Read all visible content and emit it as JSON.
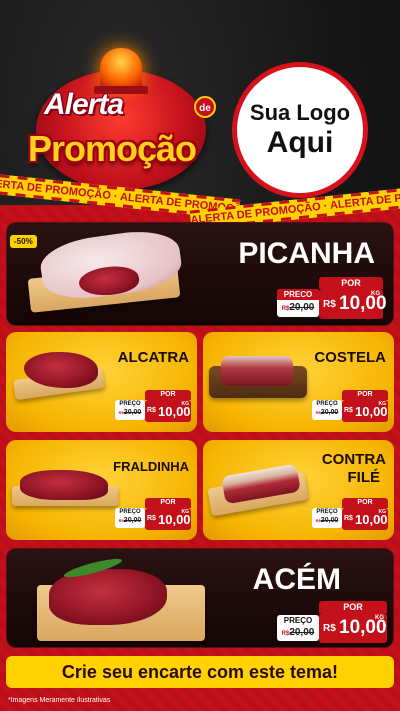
{
  "header": {
    "alerta": "Alerta",
    "de": "de",
    "promocao": "Promoção",
    "logo_line1": "Sua Logo",
    "logo_line2": "Aqui",
    "tape_text": "ALERTA DE PROMOÇÃO · ALERTA DE PROMOÇÃO · ALERTA DE PROMOÇÃO · ALERTA DE PROMOÇÃO"
  },
  "colors": {
    "accent_red": "#c4101a",
    "accent_yellow": "#ffd200",
    "dark_panel": "#1a0808"
  },
  "products": [
    {
      "name": "PICANHA",
      "badge": "-50%",
      "preco_label": "PRECO",
      "old_price": "20,00",
      "old_prefix": "R$",
      "por_label": "POR",
      "currency": "R$",
      "price": "10,00",
      "unit": "KG"
    },
    {
      "name": "ALCATRA",
      "preco_label": "PREÇO",
      "old_price": "20,00",
      "old_prefix": "R$",
      "por_label": "POR",
      "currency": "R$",
      "price": "10,00",
      "unit": "KG"
    },
    {
      "name": "COSTELA",
      "preco_label": "PREÇO",
      "old_price": "20,00",
      "old_prefix": "R$",
      "por_label": "POR",
      "currency": "R$",
      "price": "10,00",
      "unit": "KG"
    },
    {
      "name": "FRALDINHA",
      "preco_label": "PREÇO",
      "old_price": "20,00",
      "old_prefix": "R$",
      "por_label": "POR",
      "currency": "R$",
      "price": "10,00",
      "unit": "KG"
    },
    {
      "name_line1": "CONTRA",
      "name_line2": "FILÉ",
      "preco_label": "PREÇO",
      "old_price": "20,00",
      "old_prefix": "R$",
      "por_label": "POR",
      "currency": "R$",
      "price": "10,00",
      "unit": "KG"
    },
    {
      "name": "ACÉM",
      "preco_label": "PREÇO",
      "old_price": "20,00",
      "old_prefix": "R$",
      "por_label": "POR",
      "currency": "R$",
      "price": "10,00",
      "unit": "KG"
    }
  ],
  "banner": "Crie seu encarte com este tema!",
  "disclaimer": "*Imagens Meramente Ilustrativas"
}
